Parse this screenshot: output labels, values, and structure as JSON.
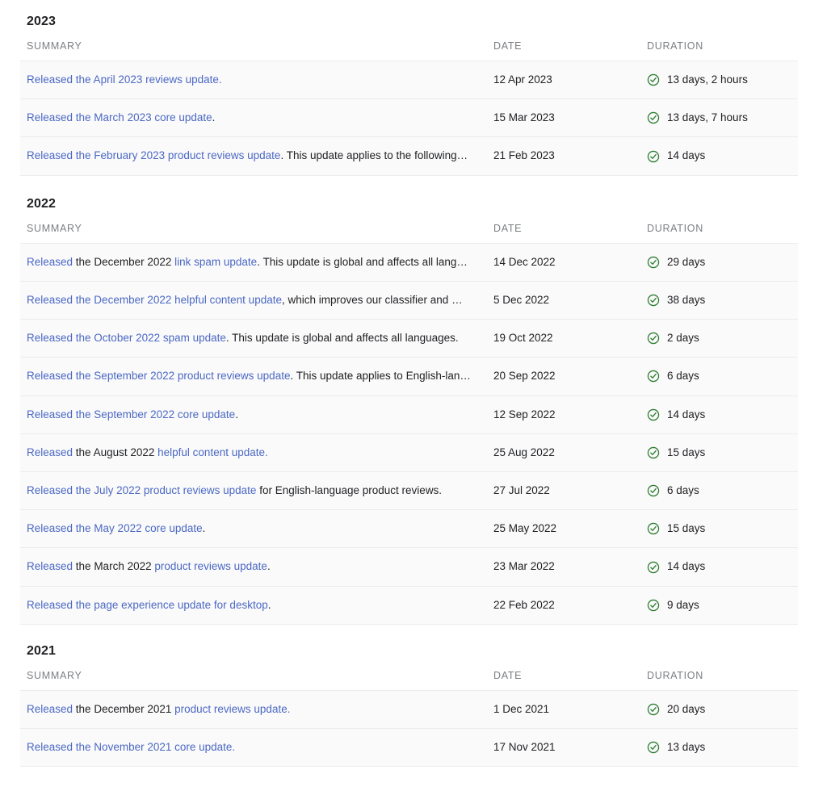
{
  "theme": {
    "link_color": "#4b68c4",
    "text_color": "#202124",
    "header_color": "#7b7f83",
    "row_background": "#fafafa",
    "border_color": "#ececec",
    "check_color": "#2e7d32"
  },
  "columns": {
    "summary": "SUMMARY",
    "date": "DATE",
    "duration": "DURATION"
  },
  "sections": [
    {
      "year": "2023",
      "rows": [
        {
          "segments": [
            {
              "text": "Released the April 2023 reviews update.",
              "link": true
            }
          ],
          "date": "12 Apr 2023",
          "duration": "13 days, 2 hours",
          "status_icon": "check-circle-icon"
        },
        {
          "segments": [
            {
              "text": "Released the March 2023 core update",
              "link": true
            },
            {
              "text": ".",
              "link": false
            }
          ],
          "date": "15 Mar 2023",
          "duration": "13 days, 7 hours",
          "status_icon": "check-circle-icon"
        },
        {
          "segments": [
            {
              "text": "Released the February 2023 product reviews update",
              "link": true
            },
            {
              "text": ". This update applies to the following…",
              "link": false
            }
          ],
          "date": "21 Feb 2023",
          "duration": "14 days",
          "status_icon": "check-circle-icon"
        }
      ]
    },
    {
      "year": "2022",
      "rows": [
        {
          "segments": [
            {
              "text": "Released",
              "link": true
            },
            {
              "text": " the December 2022 ",
              "link": false
            },
            {
              "text": "link spam update",
              "link": true
            },
            {
              "text": ". This update is global and affects all lang…",
              "link": false
            }
          ],
          "date": "14 Dec 2022",
          "duration": "29 days",
          "status_icon": "check-circle-icon"
        },
        {
          "segments": [
            {
              "text": "Released the December 2022 helpful content update",
              "link": true
            },
            {
              "text": ", which improves our classifier and …",
              "link": false
            }
          ],
          "date": "5 Dec 2022",
          "duration": "38 days",
          "status_icon": "check-circle-icon"
        },
        {
          "segments": [
            {
              "text": "Released the October 2022 spam update",
              "link": true
            },
            {
              "text": ". This update is global and affects all languages.",
              "link": false
            }
          ],
          "date": "19 Oct 2022",
          "duration": "2 days",
          "status_icon": "check-circle-icon"
        },
        {
          "segments": [
            {
              "text": "Released the September 2022 product reviews update",
              "link": true
            },
            {
              "text": ". This update applies to English-lan…",
              "link": false
            }
          ],
          "date": "20 Sep 2022",
          "duration": "6 days",
          "status_icon": "check-circle-icon"
        },
        {
          "segments": [
            {
              "text": "Released the September 2022 core update",
              "link": true
            },
            {
              "text": ".",
              "link": false
            }
          ],
          "date": "12 Sep 2022",
          "duration": "14 days",
          "status_icon": "check-circle-icon"
        },
        {
          "segments": [
            {
              "text": "Released",
              "link": true
            },
            {
              "text": " the August 2022 ",
              "link": false
            },
            {
              "text": "helpful content update.",
              "link": true
            }
          ],
          "date": "25 Aug 2022",
          "duration": "15 days",
          "status_icon": "check-circle-icon"
        },
        {
          "segments": [
            {
              "text": "Released the July 2022 product reviews update",
              "link": true
            },
            {
              "text": " for English-language product reviews.",
              "link": false
            }
          ],
          "date": "27 Jul 2022",
          "duration": "6 days",
          "status_icon": "check-circle-icon"
        },
        {
          "segments": [
            {
              "text": "Released the May 2022 core update",
              "link": true
            },
            {
              "text": ".",
              "link": false
            }
          ],
          "date": "25 May 2022",
          "duration": "15 days",
          "status_icon": "check-circle-icon"
        },
        {
          "segments": [
            {
              "text": "Released",
              "link": true
            },
            {
              "text": " the March 2022 ",
              "link": false
            },
            {
              "text": "product reviews update",
              "link": true
            },
            {
              "text": ".",
              "link": false
            }
          ],
          "date": "23 Mar 2022",
          "duration": "14 days",
          "status_icon": "check-circle-icon"
        },
        {
          "segments": [
            {
              "text": "Released the page experience update for desktop",
              "link": true
            },
            {
              "text": ".",
              "link": false
            }
          ],
          "date": "22 Feb 2022",
          "duration": "9 days",
          "status_icon": "check-circle-icon"
        }
      ]
    },
    {
      "year": "2021",
      "rows": [
        {
          "segments": [
            {
              "text": "Released",
              "link": true
            },
            {
              "text": " the December 2021 ",
              "link": false
            },
            {
              "text": "product reviews update.",
              "link": true
            }
          ],
          "date": "1 Dec 2021",
          "duration": "20 days",
          "status_icon": "check-circle-icon"
        },
        {
          "segments": [
            {
              "text": "Released the November 2021 core update.",
              "link": true
            }
          ],
          "date": "17 Nov 2021",
          "duration": "13 days",
          "status_icon": "check-circle-icon"
        }
      ]
    }
  ]
}
